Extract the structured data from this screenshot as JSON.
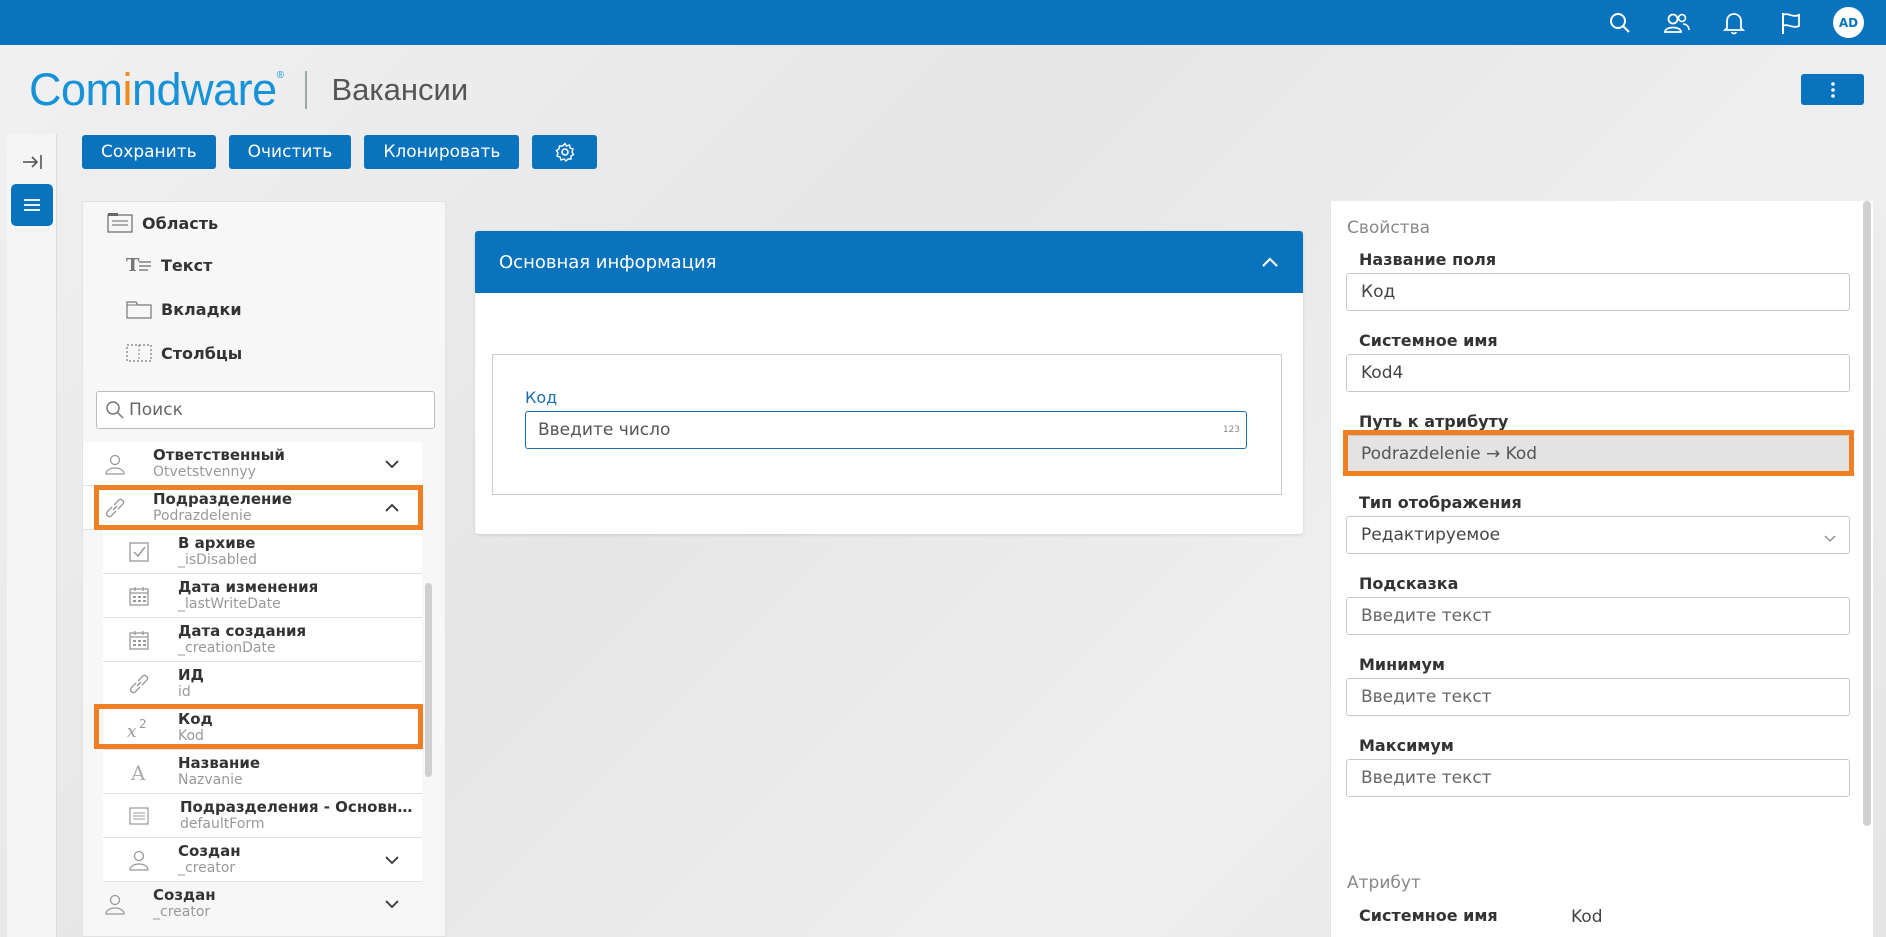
{
  "topbar": {
    "icons": [
      "search-icon",
      "users-icon",
      "bell-icon",
      "flag-icon"
    ],
    "avatar_initials": "AD"
  },
  "header": {
    "logo_part1": "Com",
    "logo_part2": "i",
    "logo_part3": "ndware",
    "logo_reg": "®",
    "app_title": "Вакансии"
  },
  "toolbar": {
    "save_label": "Сохранить",
    "clear_label": "Очистить",
    "clone_label": "Клонировать"
  },
  "palette": {
    "items": [
      {
        "label": "Область",
        "icon": "area-icon"
      },
      {
        "label": "Текст",
        "icon": "text-icon"
      },
      {
        "label": "Вкладки",
        "icon": "tabs-icon"
      },
      {
        "label": "Столбцы",
        "icon": "columns-icon"
      }
    ],
    "search_placeholder": "Поиск"
  },
  "tree": {
    "rows": [
      {
        "name": "Ответственный",
        "sys": "Otvetstvennyy",
        "icon": "user-icon",
        "chevron": "down"
      },
      {
        "name": "Подразделение",
        "sys": "Podrazdelenie",
        "icon": "link-icon",
        "chevron": "up"
      },
      {
        "name": "В архиве",
        "sys": "_isDisabled",
        "icon": "checkbox-icon"
      },
      {
        "name": "Дата изменения",
        "sys": "_lastWriteDate",
        "icon": "calendar-icon"
      },
      {
        "name": "Дата создания",
        "sys": "_creationDate",
        "icon": "calendar-icon"
      },
      {
        "name": "ИД",
        "sys": "id",
        "icon": "link-icon"
      },
      {
        "name": "Код",
        "sys": "Kod",
        "icon": "number-icon"
      },
      {
        "name": "Название",
        "sys": "Nazvanie",
        "icon": "text-a-icon"
      },
      {
        "name": "Подразделения - Основная...",
        "sys": "defaultForm",
        "icon": "form-icon"
      },
      {
        "name": "Создан",
        "sys": "_creator",
        "icon": "user-icon",
        "chevron": "down"
      },
      {
        "name": "Создан",
        "sys": "_creator",
        "icon": "user-icon",
        "chevron": "down"
      }
    ]
  },
  "form": {
    "section_title": "Основная информация",
    "field_label": "Код",
    "field_placeholder": "Введите число",
    "field_badge": "123"
  },
  "properties": {
    "title": "Свойства",
    "field_name_label": "Название поля",
    "field_name_value": "Код",
    "system_name_label": "Системное имя",
    "system_name_value": "Kod4",
    "attr_path_label": "Путь к атрибуту",
    "attr_path_value": "Podrazdelenie → Kod",
    "display_type_label": "Тип отображения",
    "display_type_value": "Редактируемое",
    "hint_label": "Подсказка",
    "hint_placeholder": "Введите текст",
    "min_label": "Минимум",
    "min_placeholder": "Введите текст",
    "max_label": "Максимум",
    "max_placeholder": "Введите текст",
    "attribute_title": "Атрибут",
    "attr_system_label": "Системное имя",
    "attr_system_value": "Kod"
  },
  "colors": {
    "brand_blue": "#0a73be",
    "highlight_orange": "#f07f23"
  }
}
